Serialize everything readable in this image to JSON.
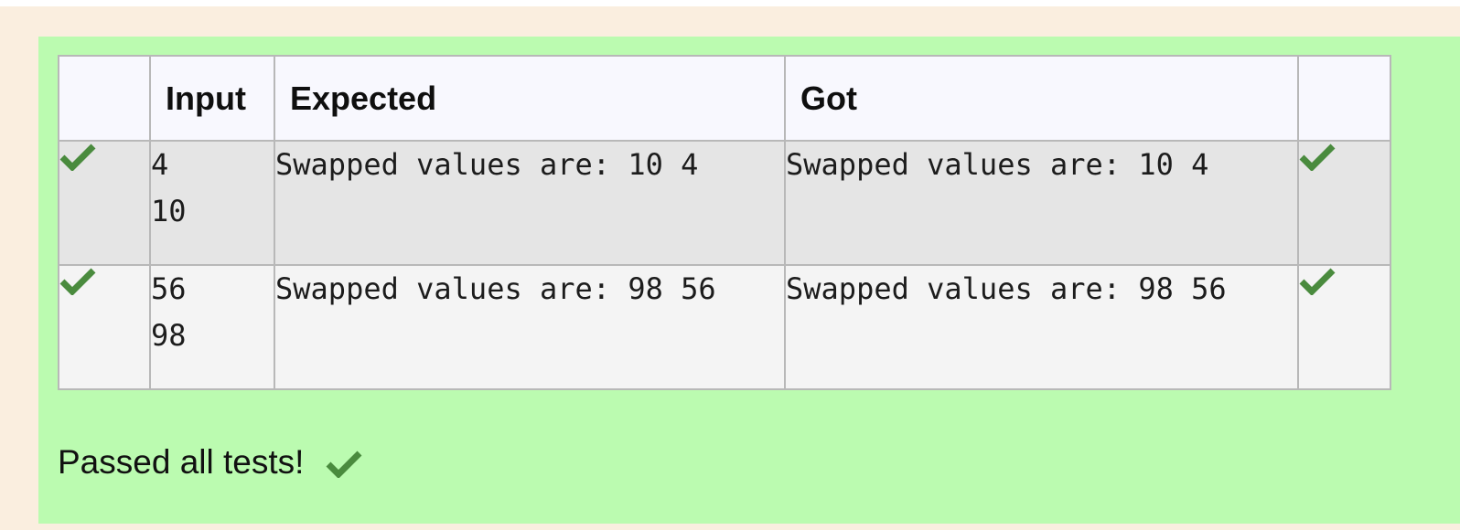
{
  "colors": {
    "outer_background": "#faeedf",
    "pass_panel": "#bbfbb0",
    "header_row": "#f8f8fe",
    "row_odd": "#e5e5e5",
    "row_even": "#f4f4f4",
    "check_icon": "#4a8b3e"
  },
  "table": {
    "headers": [
      "",
      "Input",
      "Expected",
      "Got",
      ""
    ],
    "rows": [
      {
        "status_icon": "check-icon",
        "input": "4\n10",
        "expected": "Swapped values are: 10 4",
        "got": "Swapped values are: 10 4",
        "result_icon": "check-icon"
      },
      {
        "status_icon": "check-icon",
        "input": "56\n98",
        "expected": "Swapped values are: 98 56",
        "got": "Swapped values are: 98 56",
        "result_icon": "check-icon"
      }
    ]
  },
  "summary": {
    "text": "Passed all tests!",
    "icon": "check-icon"
  }
}
